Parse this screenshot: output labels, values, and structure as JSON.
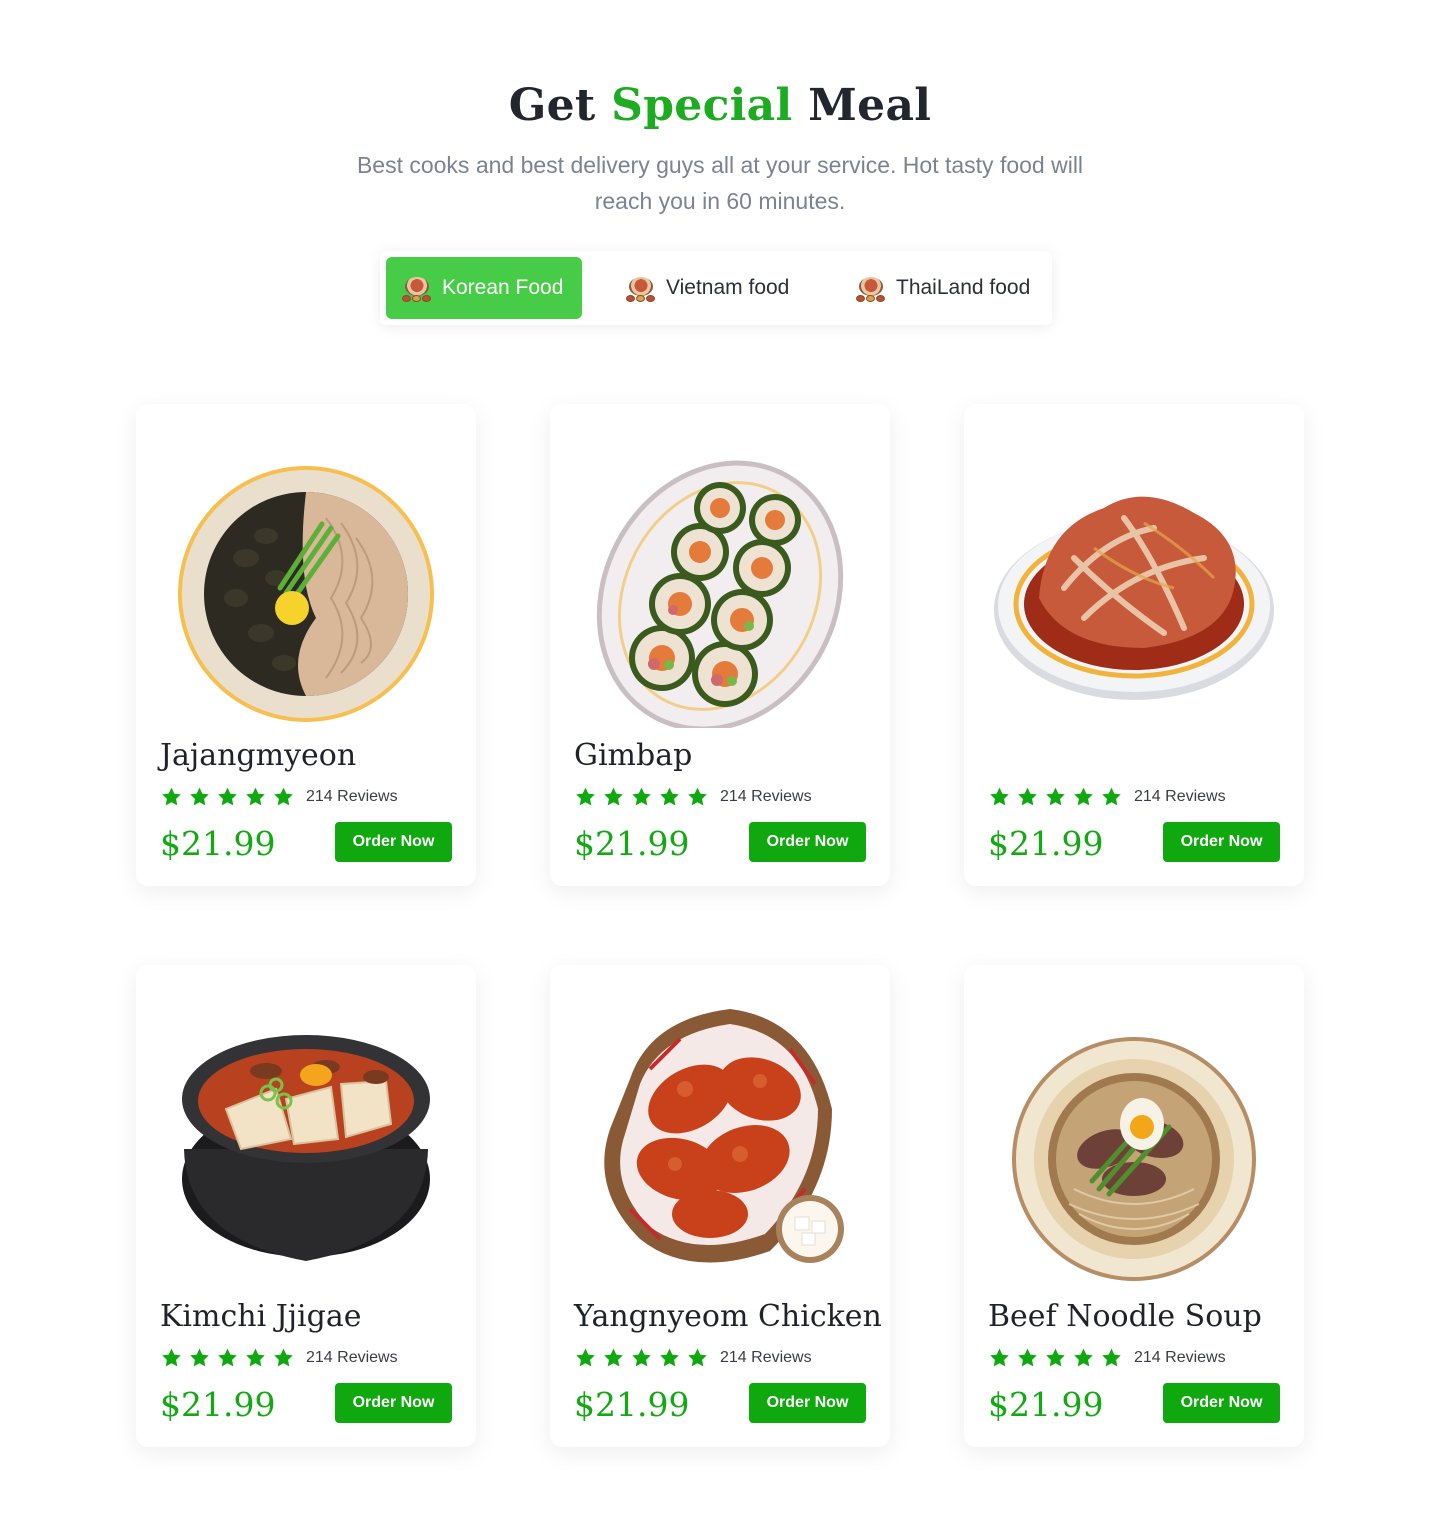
{
  "header": {
    "title_part1": "Get",
    "title_accent": "Special",
    "title_part2": "Meal",
    "subtitle": "Best cooks and best delivery guys all at your service. Hot tasty food will reach you in 60 minutes."
  },
  "tabs": [
    {
      "label": "Korean Food",
      "active": true
    },
    {
      "label": "Vietnam food",
      "active": false
    },
    {
      "label": "ThaiLand food",
      "active": false
    }
  ],
  "colors": {
    "accent": "#1dab21",
    "active_tab": "#47cc47",
    "button": "#0fa80f",
    "star": "#0fa80f"
  },
  "cards": [
    {
      "name": "Jajangmyeon",
      "rating": 5,
      "reviews": "214 Reviews",
      "price": "$21.99",
      "button": "Order Now",
      "image": "jajangmyeon-illustration"
    },
    {
      "name": "Gimbap",
      "rating": 5,
      "reviews": "214 Reviews",
      "price": "$21.99",
      "button": "Order Now",
      "image": "gimbap-illustration"
    },
    {
      "name": "",
      "rating": 5,
      "reviews": "214 Reviews",
      "price": "$21.99",
      "button": "Order Now",
      "image": "kimchi-illustration"
    },
    {
      "name": "Kimchi Jjigae",
      "rating": 5,
      "reviews": "214 Reviews",
      "price": "$21.99",
      "button": "Order Now",
      "image": "kimchi-jjigae-illustration"
    },
    {
      "name": "Yangnyeom Chicken",
      "rating": 5,
      "reviews": "214 Reviews",
      "price": "$21.99",
      "button": "Order Now",
      "image": "yangnyeom-chicken-illustration"
    },
    {
      "name": "Beef Noodle Soup",
      "rating": 5,
      "reviews": "214 Reviews",
      "price": "$21.99",
      "button": "Order Now",
      "image": "beef-noodle-soup-illustration"
    }
  ]
}
